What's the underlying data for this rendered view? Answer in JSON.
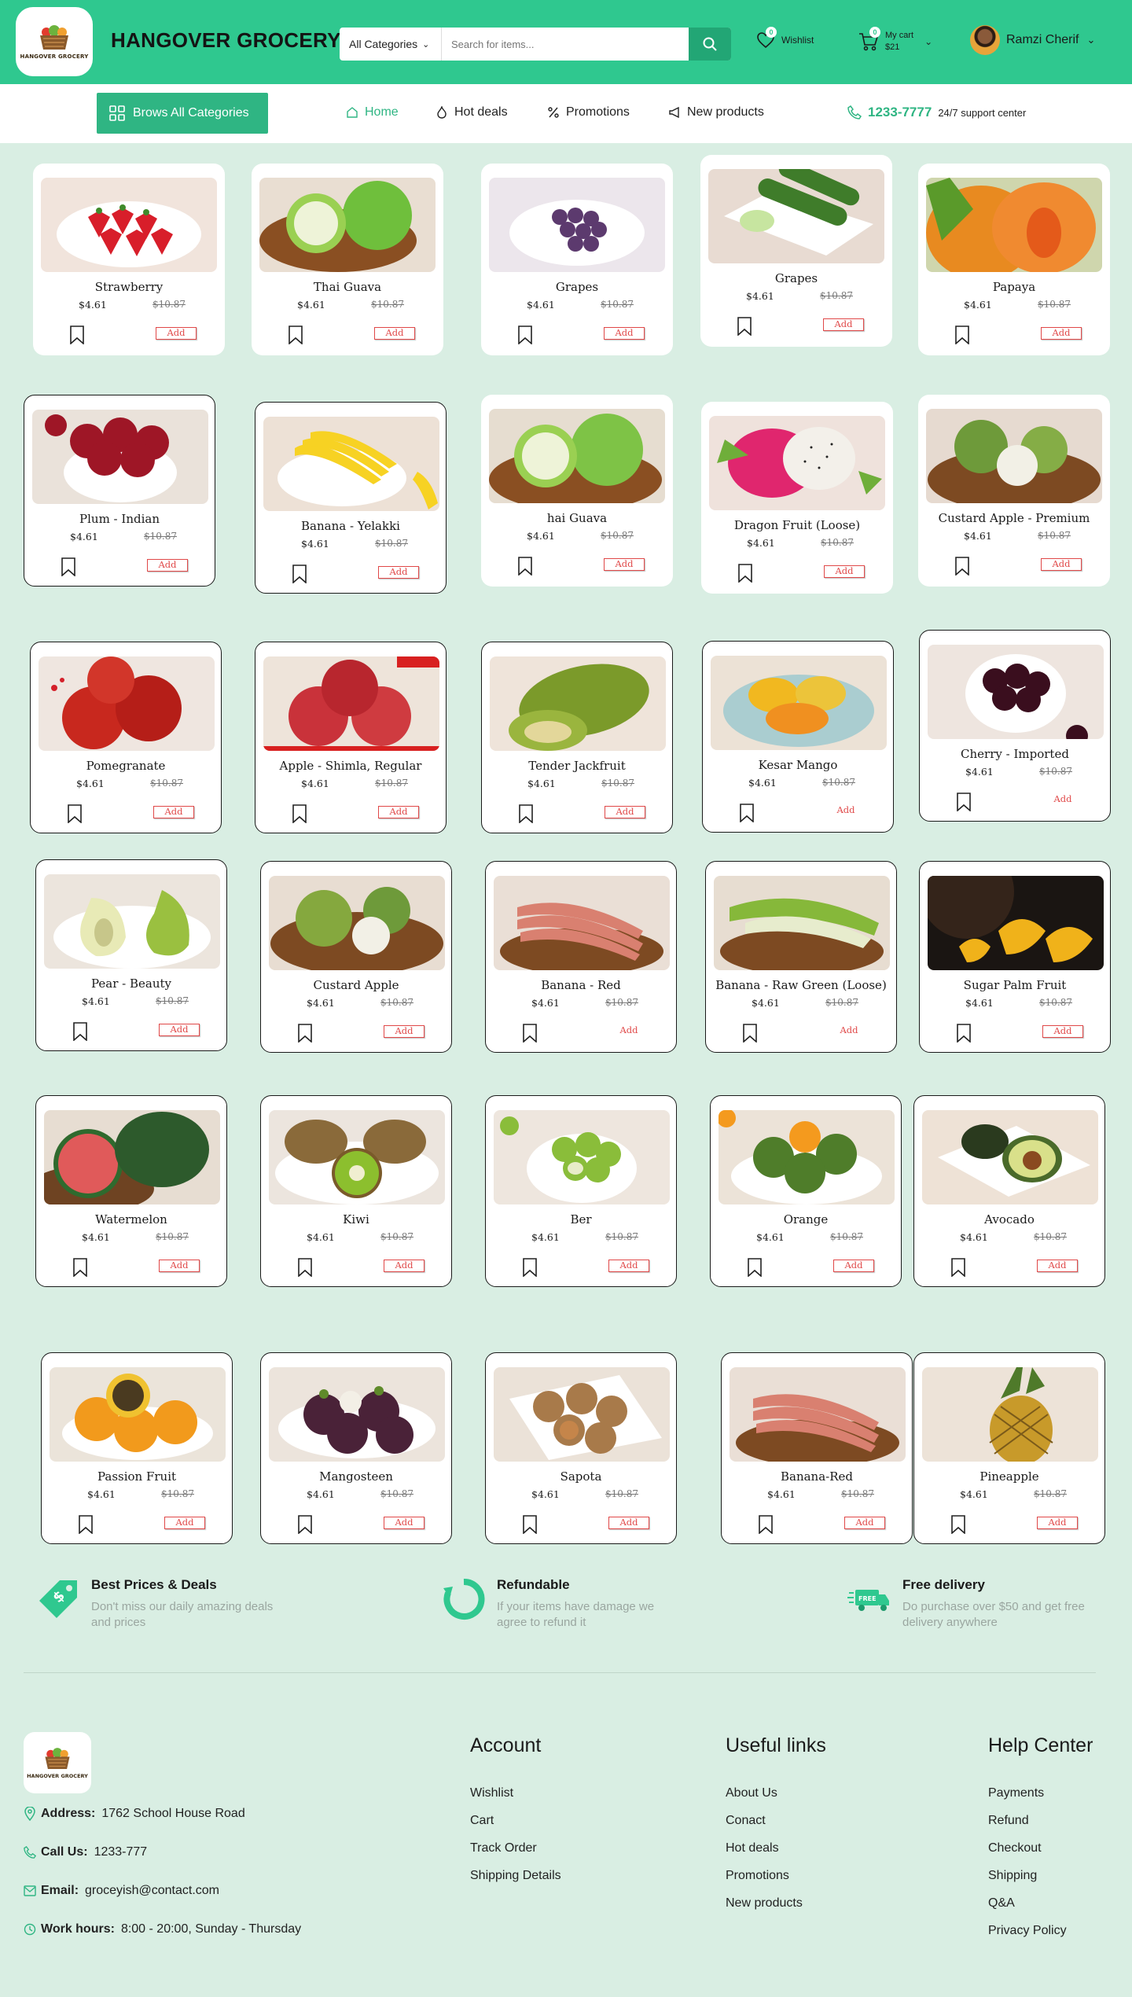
{
  "header": {
    "brand": "HANGOVER GROCERY",
    "logo_text": "HANGOVER GROCERY",
    "category_select": "All Categories",
    "search_placeholder": "Search for items...",
    "wishlist_label": "Wishlist",
    "wishlist_count": "0",
    "cart_label": "My cart",
    "cart_total": "$21",
    "cart_count": "0",
    "user_name": "Ramzi Cherif"
  },
  "nav": {
    "browse_label": "Brows All Categories",
    "items": [
      {
        "label": "Home",
        "icon": "home-icon"
      },
      {
        "label": "Hot deals",
        "icon": "flame-icon"
      },
      {
        "label": "Promotions",
        "icon": "percent-icon"
      },
      {
        "label": "New products",
        "icon": "megaphone-icon"
      }
    ],
    "support_phone": "1233-7777",
    "support_label": "24/7 support center"
  },
  "products": [
    {
      "name": "Strawberry",
      "price": "$4.61",
      "old_price": "$10.87",
      "add": "Add"
    },
    {
      "name": "Thai Guava",
      "price": "$4.61",
      "old_price": "$10.87",
      "add": "Add"
    },
    {
      "name": "Grapes",
      "price": "$4.61",
      "old_price": "$10.87",
      "add": "Add"
    },
    {
      "name": "Grapes",
      "price": "$4.61",
      "old_price": "$10.87",
      "add": "Add"
    },
    {
      "name": "Papaya",
      "price": "$4.61",
      "old_price": "$10.87",
      "add": "Add"
    },
    {
      "name": "Plum - Indian",
      "price": "$4.61",
      "old_price": "$10.87",
      "add": "Add"
    },
    {
      "name": "Banana - Yelakki",
      "price": "$4.61",
      "old_price": "$10.87",
      "add": "Add"
    },
    {
      "name": "hai Guava",
      "price": "$4.61",
      "old_price": "$10.87",
      "add": "Add"
    },
    {
      "name": "Dragon Fruit (Loose)",
      "price": "$4.61",
      "old_price": "$10.87",
      "add": "Add"
    },
    {
      "name": "Custard Apple - Premium",
      "price": "$4.61",
      "old_price": "$10.87",
      "add": "Add"
    },
    {
      "name": "Pomegranate",
      "price": "$4.61",
      "old_price": "$10.87",
      "add": "Add"
    },
    {
      "name": "Apple - Shimla, Regular",
      "price": "$4.61",
      "old_price": "$10.87",
      "add": "Add"
    },
    {
      "name": "Tender Jackfruit",
      "price": "$4.61",
      "old_price": "$10.87",
      "add": "Add"
    },
    {
      "name": "Kesar Mango",
      "price": "$4.61",
      "old_price": "$10.87",
      "add": "Add"
    },
    {
      "name": "Cherry - Imported",
      "price": "$4.61",
      "old_price": "$10.87",
      "add": "Add"
    },
    {
      "name": "Pear - Beauty",
      "price": "$4.61",
      "old_price": "$10.87",
      "add": "Add"
    },
    {
      "name": "Custard Apple",
      "price": "$4.61",
      "old_price": "$10.87",
      "add": "Add"
    },
    {
      "name": "Banana - Red",
      "price": "$4.61",
      "old_price": "$10.87",
      "add": "Add"
    },
    {
      "name": "Banana - Raw Green (Loose)",
      "price": "$4.61",
      "old_price": "$10.87",
      "add": "Add"
    },
    {
      "name": "Sugar Palm Fruit",
      "price": "$4.61",
      "old_price": "$10.87",
      "add": "Add"
    },
    {
      "name": "Watermelon",
      "price": "$4.61",
      "old_price": "$10.87",
      "add": "Add"
    },
    {
      "name": "Kiwi",
      "price": "$4.61",
      "old_price": "$10.87",
      "add": "Add"
    },
    {
      "name": "Ber",
      "price": "$4.61",
      "old_price": "$10.87",
      "add": "Add"
    },
    {
      "name": "Orange",
      "price": "$4.61",
      "old_price": "$10.87",
      "add": "Add"
    },
    {
      "name": "Avocado",
      "price": "$4.61",
      "old_price": "$10.87",
      "add": "Add"
    },
    {
      "name": "Passion Fruit",
      "price": "$4.61",
      "old_price": "$10.87",
      "add": "Add"
    },
    {
      "name": "Mangosteen",
      "price": "$4.61",
      "old_price": "$10.87",
      "add": "Add"
    },
    {
      "name": "Sapota",
      "price": "$4.61",
      "old_price": "$10.87",
      "add": "Add"
    },
    {
      "name": "Banana-Red",
      "price": "$4.61",
      "old_price": "$10.87",
      "add": "Add"
    },
    {
      "name": "Pineapple",
      "price": "$4.61",
      "old_price": "$10.87",
      "add": "Add"
    }
  ],
  "features": [
    {
      "title": "Best Prices & Deals",
      "desc": "Don't miss our daily amazing deals and prices",
      "icon": "price-tag-icon"
    },
    {
      "title": "Refundable",
      "desc": "If your items have damage we agree to refund it",
      "icon": "refund-icon"
    },
    {
      "title": "Free delivery",
      "desc": "Do purchase over $50 and get free delivery anywhere",
      "icon": "delivery-truck-icon"
    }
  ],
  "footer": {
    "address_label": "Address:",
    "address": "1762 School House Road",
    "call_label": "Call Us:",
    "call": "1233-777",
    "email_label": "Email:",
    "email": "groceyish@contact.com",
    "hours_label": "Work hours:",
    "hours": "8:00 - 20:00, Sunday -  Thursday",
    "account_title": "Account",
    "account_links": [
      "Wishlist",
      "Cart",
      "Track Order",
      "Shipping Details"
    ],
    "useful_title": "Useful links",
    "useful_links": [
      "About Us",
      "Conact",
      "Hot deals",
      "Promotions",
      "New products"
    ],
    "help_title": "Help Center",
    "help_links": [
      "Payments",
      "Refund",
      "Checkout",
      "Shipping",
      "Q&A",
      "Privacy Policy"
    ]
  },
  "colors": {
    "brand_green": "#2fc88f",
    "accent_green": "#2fb583",
    "add_red": "#e04848",
    "page_bg": "#d9eee3"
  }
}
